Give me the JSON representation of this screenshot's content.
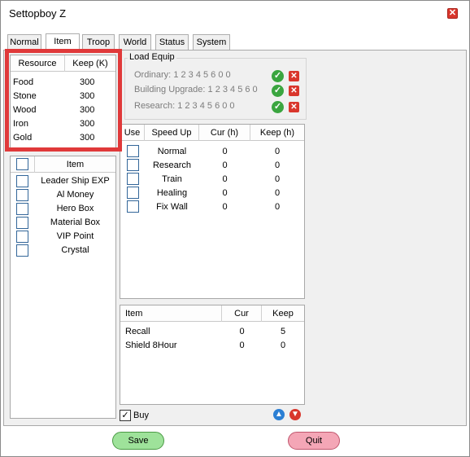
{
  "window": {
    "title": "Settopboy Z"
  },
  "tabs": [
    {
      "label": "Normal"
    },
    {
      "label": "Item"
    },
    {
      "label": "Troop"
    },
    {
      "label": "World"
    },
    {
      "label": "Status"
    },
    {
      "label": "System"
    }
  ],
  "active_tab": "Item",
  "resource_table": {
    "headers": [
      "Resource",
      "Keep (K)"
    ],
    "rows": [
      {
        "resource": "Food",
        "keep": "300"
      },
      {
        "resource": "Stone",
        "keep": "300"
      },
      {
        "resource": "Wood",
        "keep": "300"
      },
      {
        "resource": "Iron",
        "keep": "300"
      },
      {
        "resource": "Gold",
        "keep": "300"
      }
    ]
  },
  "item_list": {
    "header": "Item",
    "rows": [
      {
        "label": "Leader Ship EXP"
      },
      {
        "label": "Al Money"
      },
      {
        "label": "Hero Box"
      },
      {
        "label": "Material Box"
      },
      {
        "label": "VIP Point"
      },
      {
        "label": "Crystal"
      }
    ]
  },
  "load_equip": {
    "title": "Load Equip",
    "rows": [
      {
        "label": "Ordinary:",
        "value": "1 2 3 4 5 6 0 0"
      },
      {
        "label": "Building Upgrade:",
        "value": "1 2 3 4 5 6 0"
      },
      {
        "label": "Research:",
        "value": "1 2 3 4 5 6 0 0"
      }
    ]
  },
  "speedup_table": {
    "headers": [
      "Use",
      "Speed Up",
      "Cur (h)",
      "Keep (h)"
    ],
    "rows": [
      {
        "name": "Normal",
        "cur": "0",
        "keep": "0"
      },
      {
        "name": "Research",
        "cur": "0",
        "keep": "0"
      },
      {
        "name": "Train",
        "cur": "0",
        "keep": "0"
      },
      {
        "name": "Healing",
        "cur": "0",
        "keep": "0"
      },
      {
        "name": "Fix Wall",
        "cur": "0",
        "keep": "0"
      }
    ]
  },
  "items_table": {
    "headers": [
      "Item",
      "Cur",
      "Keep"
    ],
    "rows": [
      {
        "name": "Recall",
        "cur": "0",
        "keep": "5"
      },
      {
        "name": "Shield 8Hour",
        "cur": "0",
        "keep": "0"
      }
    ]
  },
  "buy": {
    "label": "Buy",
    "checked": true
  },
  "buttons": {
    "save": "Save",
    "quit": "Quit"
  },
  "colors": {
    "highlight_red": "#e0393a",
    "save_green": "#9ee29a",
    "quit_pink": "#f4a6b6",
    "ok_green": "#3aa53f",
    "delete_red": "#d9362c",
    "up_blue": "#2b7fd4",
    "down_red": "#d9362c"
  },
  "icons": {
    "close": "close-icon",
    "ok": "check-icon",
    "delete": "x-icon",
    "up": "arrow-up-icon",
    "down": "arrow-down-icon"
  }
}
